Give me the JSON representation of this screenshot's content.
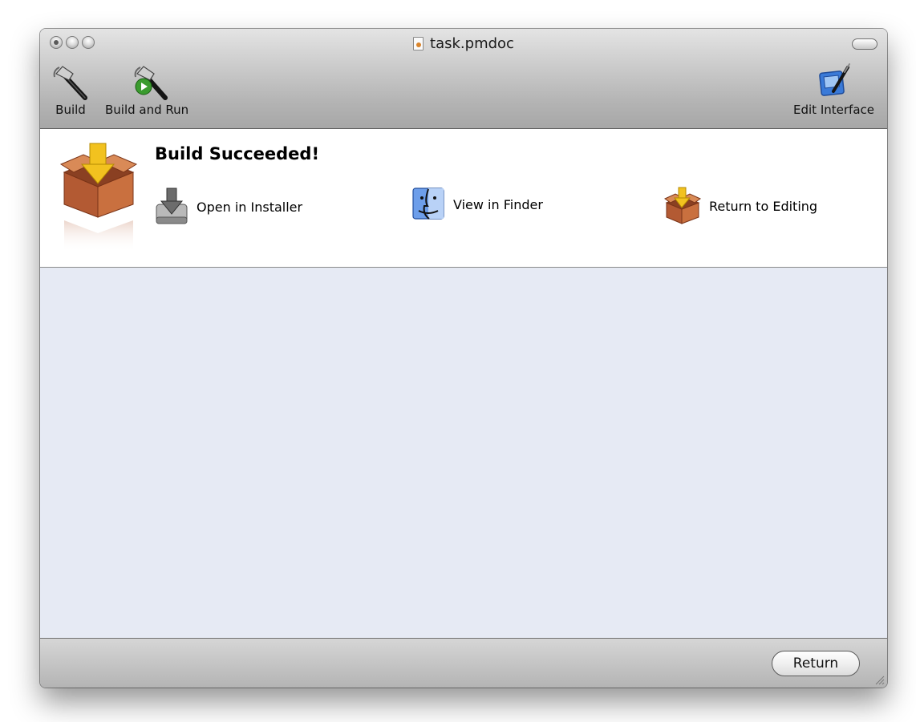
{
  "window": {
    "title": "task.pmdoc"
  },
  "toolbar": {
    "build_label": "Build",
    "build_and_run_label": "Build and Run",
    "edit_interface_label": "Edit Interface"
  },
  "result": {
    "heading": "Build Succeeded!",
    "actions": [
      {
        "label": "Open in Installer",
        "icon": "installer-disk-icon"
      },
      {
        "label": "View in Finder",
        "icon": "finder-icon"
      },
      {
        "label": "Return to Editing",
        "icon": "package-box-icon"
      }
    ]
  },
  "footer": {
    "return_label": "Return"
  },
  "colors": {
    "content_background": "#e6eaf4",
    "accent_yellow": "#f2c21f",
    "box_brown": "#b35a33"
  }
}
